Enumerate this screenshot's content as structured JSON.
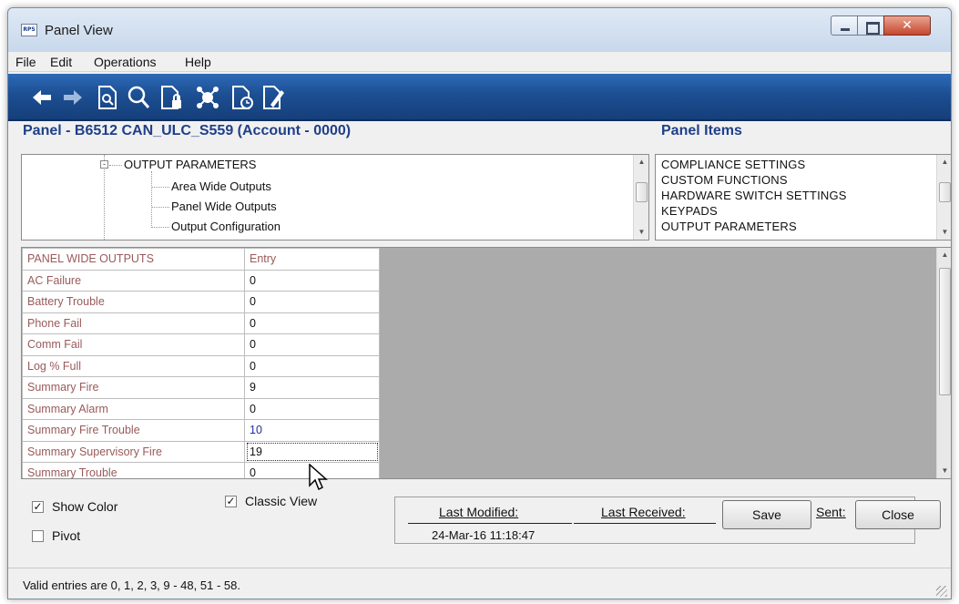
{
  "window": {
    "title": "Panel View",
    "app_icon_text": "RPS"
  },
  "menu": [
    "File",
    "Edit",
    "Operations",
    "Help"
  ],
  "toolbar": {
    "icons": [
      "back-arrow-icon",
      "forward-arrow-icon",
      "document-search-icon",
      "magnifier-icon",
      "document-lock-icon",
      "network-icon",
      "document-clock-icon",
      "document-edit-icon"
    ]
  },
  "panel": {
    "title": "Panel - B6512 CAN_ULC_S559 (Account - 0000)"
  },
  "panel_items": {
    "title": "Panel Items",
    "items": [
      "COMPLIANCE SETTINGS",
      "CUSTOM FUNCTIONS",
      "HARDWARE SWITCH SETTINGS",
      "KEYPADS",
      "OUTPUT PARAMETERS"
    ]
  },
  "tree": {
    "parent": "OUTPUT PARAMETERS",
    "toggle": "-",
    "children": [
      "Area Wide Outputs",
      "Panel Wide Outputs",
      "Output Configuration"
    ]
  },
  "grid": {
    "header": {
      "label": "PANEL WIDE OUTPUTS",
      "entry": "Entry"
    },
    "rows": [
      {
        "label": "AC Failure",
        "value": "0"
      },
      {
        "label": "Battery Trouble",
        "value": "0"
      },
      {
        "label": "Phone Fail",
        "value": "0"
      },
      {
        "label": "Comm Fail",
        "value": "0"
      },
      {
        "label": "Log % Full",
        "value": "0"
      },
      {
        "label": "Summary Fire",
        "value": "9"
      },
      {
        "label": "Summary Alarm",
        "value": "0"
      },
      {
        "label": "Summary Fire Trouble",
        "value": "10"
      },
      {
        "label": "Summary Supervisory Fire",
        "value": "19"
      },
      {
        "label": "Summary Trouble",
        "value": "0"
      }
    ]
  },
  "options": {
    "show_color": {
      "label": "Show Color",
      "checked": "✓"
    },
    "classic_view": {
      "label": "Classic View",
      "checked": "✓"
    },
    "pivot": {
      "label": "Pivot",
      "checked": ""
    }
  },
  "info": {
    "last_modified_label": "Last Modified:",
    "last_modified_value": "24-Mar-16 11:18:47",
    "last_received_label": "Last Received:",
    "sent_label": "Sent:"
  },
  "buttons": {
    "save": "Save",
    "close": "Close"
  },
  "status": {
    "text": "Valid entries are 0, 1, 2, 3, 9 - 48, 51 - 58."
  },
  "colors": {
    "toolbar_blue": "#1c4f93",
    "title_blue": "#1f3f8a",
    "label_red": "#9a5a5a",
    "grid_bg": "#ababab"
  }
}
